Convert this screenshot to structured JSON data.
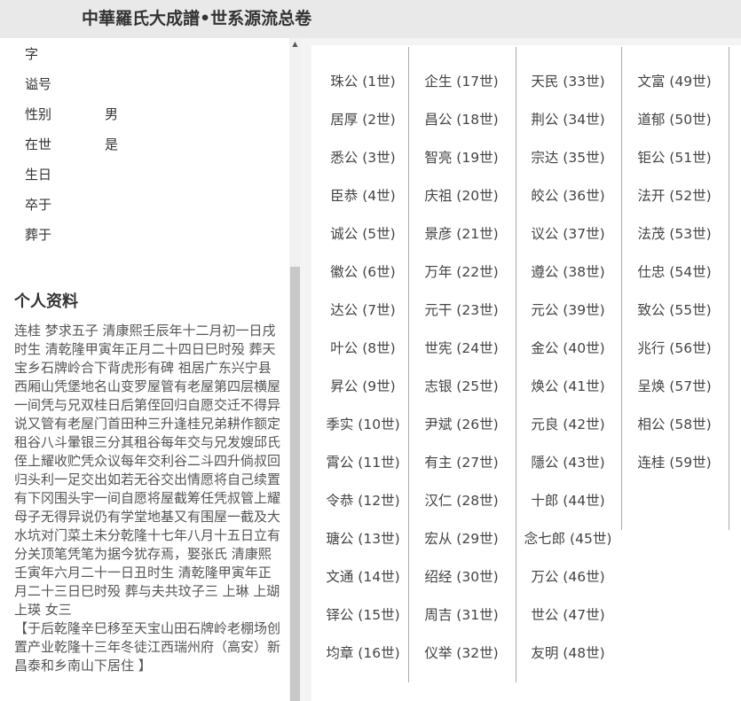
{
  "header": {
    "title": "中華羅氏大成譜•世系源流总卷"
  },
  "info": [
    {
      "label": "字",
      "value": ""
    },
    {
      "label": "谥号",
      "value": ""
    },
    {
      "label": "性别",
      "value": "男"
    },
    {
      "label": "在世",
      "value": "是"
    },
    {
      "label": "生日",
      "value": ""
    },
    {
      "label": "卒于",
      "value": ""
    },
    {
      "label": "葬于",
      "value": ""
    }
  ],
  "profile": {
    "title": "个人资料",
    "text": "连桂 梦求五子 清康熙壬辰年十二月初一日戌时生 清乾隆甲寅年正月二十四日巳时殁 葬天宝乡石牌岭合下背虎形有碑 祖居广东兴宁县西厢山凭堡地名山变罗屋管有老屋第四层横屋一间凭与兄双桂日后第侄回归自愿交迁不得异说又管有老屋门首田种三升逢桂兄弟耕作额定租谷八斗暈银三分其租谷每年交与兄发嫂邱氏侄上耀收贮凭众议每年交利谷二斗四升倘叔回归头利一足交出如若无谷交出情愿将自己续置有下冈围头宇一间自愿将屋截筹任凭叔管上耀母子无得异说仍有学堂地基又有围屋一截及大水坑对门菜土未分乾隆十七年八月十五日立有分关顶笔凭笔为据今犹存焉，娶张氏 清康熙壬寅年六月二十一日丑时生 清乾隆甲寅年正月二十三日巳时殁 葬与夫共玟子三 上琳 上瑚 上瑛 女三",
    "note": "【于后乾隆辛巳移至天宝山田石牌岭老棚场创置产业乾隆十三年冬徒江西瑞州府（高安）新昌泰和乡南山下居住 】"
  },
  "generations": [
    [
      "珠公 (1世)",
      "居厚 (2世)",
      "悉公 (3世)",
      "臣恭 (4世)",
      "诚公 (5世)",
      "徽公 (6世)",
      "达公 (7世)",
      "叶公 (8世)",
      "昇公 (9世)",
      "季实 (10世)",
      "霄公 (11世)",
      "令恭 (12世)",
      "瑭公 (13世)",
      "文通 (14世)",
      "铎公 (15世)",
      "均章 (16世)"
    ],
    [
      "企生 (17世)",
      "昌公 (18世)",
      "智亮 (19世)",
      "庆祖 (20世)",
      "景彦 (21世)",
      "万年 (22世)",
      "元干 (23世)",
      "世宪 (24世)",
      "志银 (25世)",
      "尹斌 (26世)",
      "有主 (27世)",
      "汉仁 (28世)",
      "宏从 (29世)",
      "绍经 (30世)",
      "周吉 (31世)",
      "仪举 (32世)"
    ],
    [
      "天民 (33世)",
      "荆公 (34世)",
      "宗达 (35世)",
      "皎公 (36世)",
      "议公 (37世)",
      "遵公 (38世)",
      "元公 (39世)",
      "金公 (40世)",
      "焕公 (41世)",
      "元良 (42世)",
      "隱公 (43世)",
      "十郎 (44世)",
      "念七郎 (45世)",
      "万公 (46世)",
      "世公 (47世)",
      "友明 (48世)"
    ],
    [
      "文富 (49世)",
      "道郁 (50世)",
      "钜公 (51世)",
      "法开 (52世)",
      "法茂 (53世)",
      "仕忠 (54世)",
      "致公 (55世)",
      "兆行 (56世)",
      "呈焕 (57世)",
      "相公 (58世)",
      "连桂 (59世)"
    ]
  ]
}
